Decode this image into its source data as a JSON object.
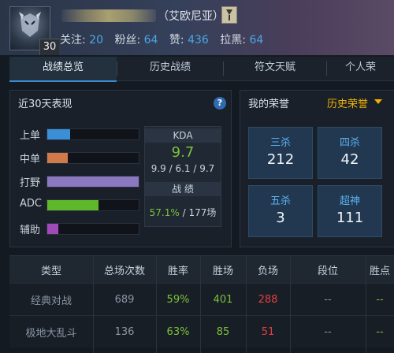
{
  "header": {
    "level": "30",
    "region": "（艾欧尼亚）",
    "follow_label": "关注:",
    "follow_count": "20",
    "fans_label": "粉丝:",
    "fans_count": "64",
    "likes_label": "赞:",
    "likes_count": "436",
    "block_label": "拉黑:",
    "block_count": "64"
  },
  "tabs": [
    {
      "label": "战绩总览",
      "active": true
    },
    {
      "label": "历史战绩",
      "active": false
    },
    {
      "label": "符文天赋",
      "active": false
    },
    {
      "label": "个人荣",
      "active": false
    }
  ],
  "recent": {
    "title": "近30天表现",
    "help": "?",
    "roles": [
      {
        "label": "上单",
        "value": 0.25,
        "color": "#3a8fd6"
      },
      {
        "label": "中单",
        "value": 0.22,
        "color": "#d07a4a"
      },
      {
        "label": "打野",
        "value": 1.0,
        "color": "#8a78c0"
      },
      {
        "label": "ADC",
        "value": 0.56,
        "color": "#5fb82a"
      },
      {
        "label": "辅助",
        "value": 0.12,
        "color": "#a04ab8"
      }
    ],
    "kda_title": "KDA",
    "kda_value": "9.7",
    "kda_detail": "9.9 / 6.1 / 9.7",
    "record_title": "战 绩",
    "win_rate": "57.1%",
    "total_games": "/ 177场"
  },
  "honors": {
    "title": "我的荣誉",
    "history_link": "历史荣誉",
    "items": [
      {
        "label": "三杀",
        "value": "212"
      },
      {
        "label": "四杀",
        "value": "42"
      },
      {
        "label": "五杀",
        "value": "3"
      },
      {
        "label": "超神",
        "value": "111"
      }
    ]
  },
  "table": {
    "headers": [
      "类型",
      "总场次数",
      "胜率",
      "胜场",
      "负场",
      "段位",
      "胜点"
    ],
    "rows": [
      [
        "经典对战",
        "689",
        "59%",
        "401",
        "288",
        "--",
        "--"
      ],
      [
        "极地大乱斗",
        "136",
        "63%",
        "85",
        "51",
        "--",
        "--"
      ]
    ]
  }
}
